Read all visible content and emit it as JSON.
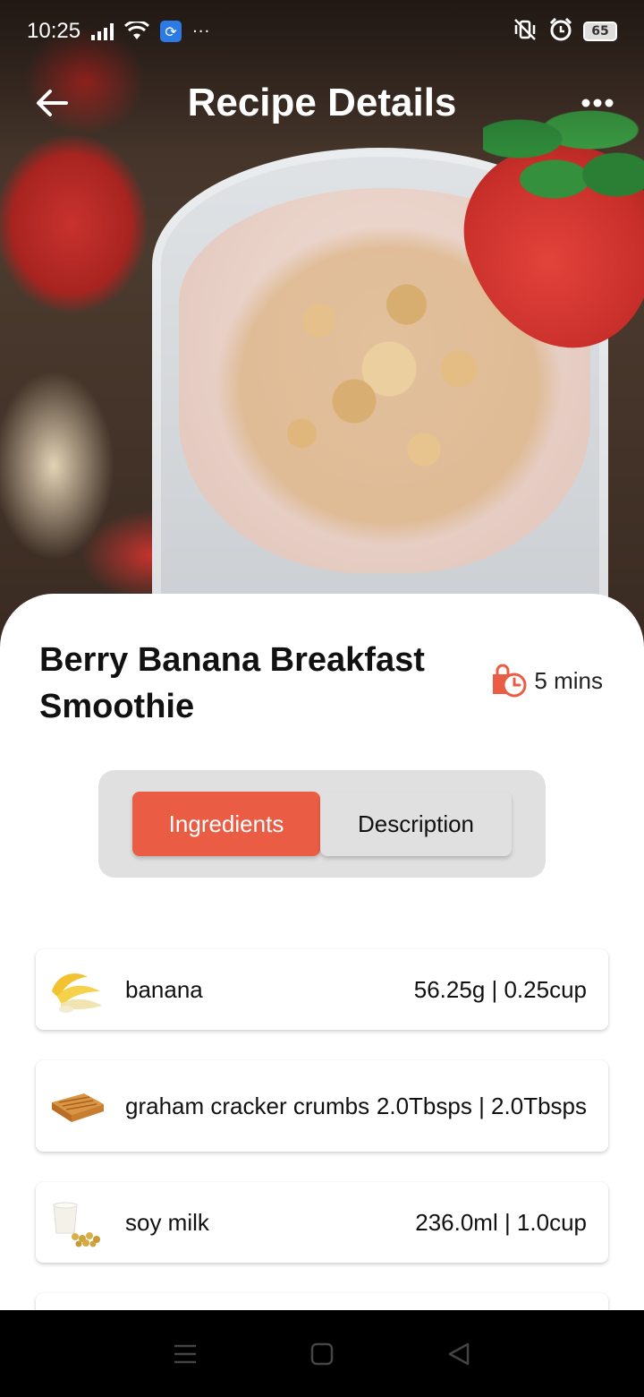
{
  "status_bar": {
    "time": "10:25",
    "more": "···",
    "battery": "65"
  },
  "header": {
    "title": "Recipe Details"
  },
  "recipe": {
    "title": "Berry Banana Breakfast Smoothie",
    "time": "5 mins"
  },
  "tabs": [
    {
      "label": "Ingredients",
      "active": true
    },
    {
      "label": "Description",
      "active": false
    }
  ],
  "ingredients": [
    {
      "name": "banana",
      "amount": "56.25g | 0.25cup",
      "icon": "banana-icon"
    },
    {
      "name": "graham cracker crumbs",
      "amount": "2.0Tbsps | 2.0Tbsps",
      "icon": "graham-cracker-icon"
    },
    {
      "name": "soy milk",
      "amount": "236.0ml | 1.0cup",
      "icon": "soy-milk-icon"
    }
  ],
  "colors": {
    "accent": "#ea5d44",
    "tab_bg": "#e0e0e0"
  }
}
